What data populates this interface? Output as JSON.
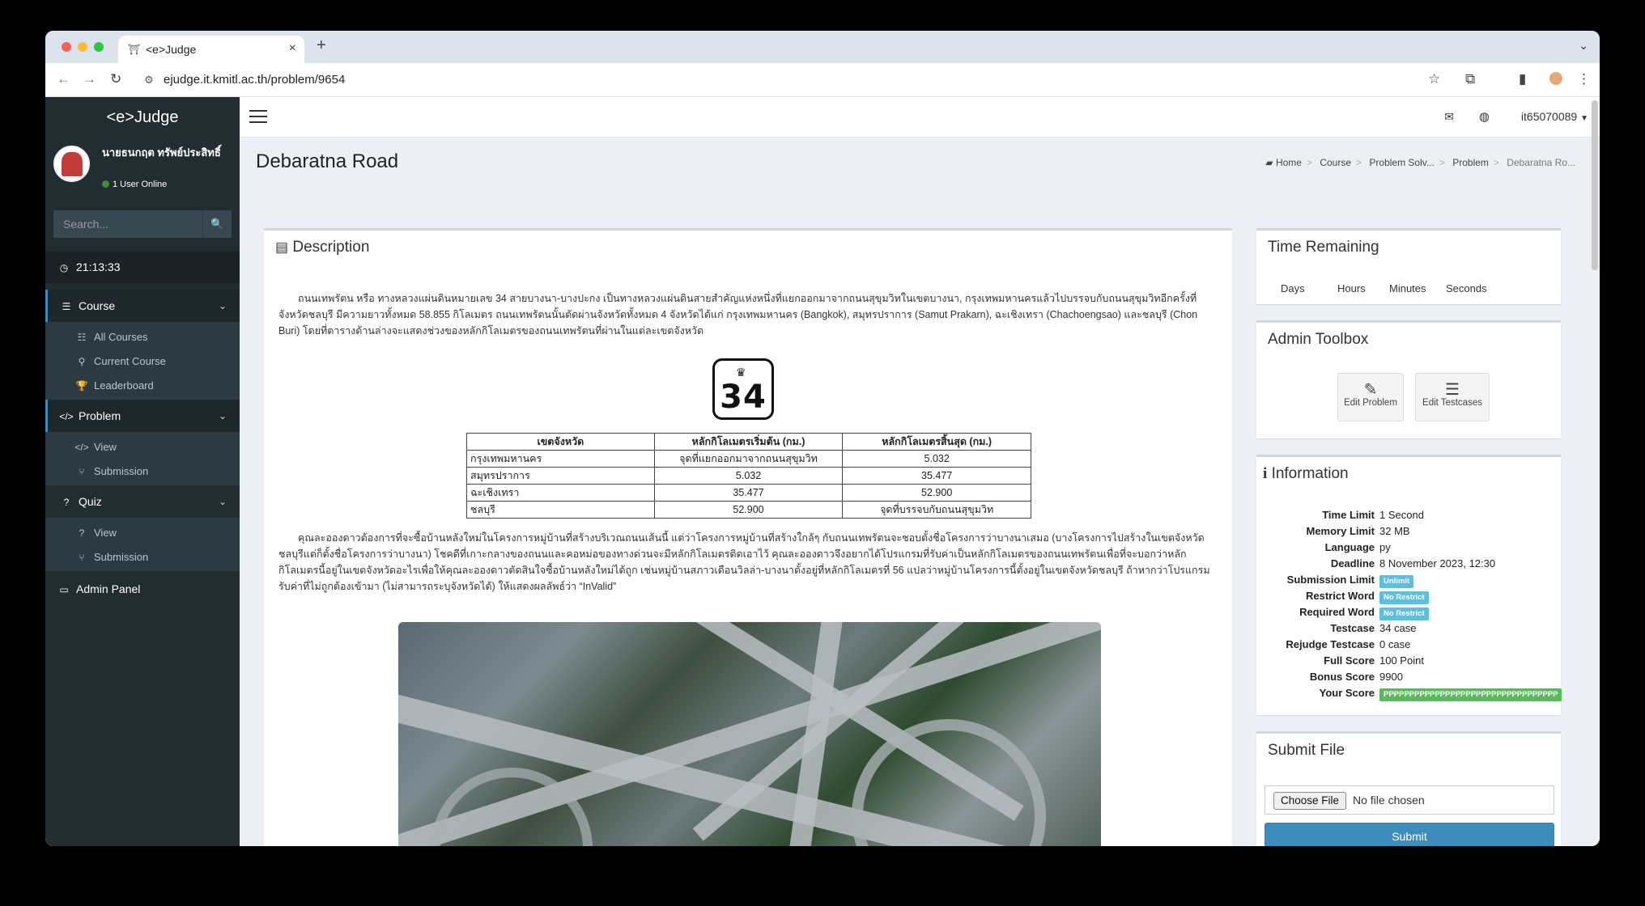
{
  "browser": {
    "tab_title": "<e>Judge",
    "url": "ejudge.it.kmitl.ac.th/problem/9654"
  },
  "sidebar": {
    "logo": "<e>Judge",
    "user_name": "นายธนกฤต ทรัพย์ประสิทธิ์",
    "user_online": "1 User Online",
    "search_placeholder": "Search...",
    "clock": "21:13:33",
    "sections": [
      {
        "label": "Course",
        "icon": "list-icon",
        "items": [
          {
            "label": "All Courses",
            "icon": "list-icon"
          },
          {
            "label": "Current Course",
            "icon": "map-marker-icon"
          },
          {
            "label": "Leaderboard",
            "icon": "trophy-icon"
          }
        ]
      },
      {
        "label": "Problem",
        "icon": "code-icon",
        "items": [
          {
            "label": "View",
            "icon": "code-icon"
          },
          {
            "label": "Submission",
            "icon": "branch-icon"
          }
        ]
      },
      {
        "label": "Quiz",
        "icon": "question-icon",
        "items": [
          {
            "label": "View",
            "icon": "question-icon"
          },
          {
            "label": "Submission",
            "icon": "branch-icon"
          }
        ]
      }
    ],
    "admin_panel": "Admin Panel"
  },
  "navbar": {
    "username": "it65070089"
  },
  "page": {
    "title": "Debaratna Road",
    "breadcrumb": [
      "Home",
      "Course",
      "Problem Solv...",
      "Problem",
      "Debaratna Ro..."
    ]
  },
  "description": {
    "title": "Description",
    "paragraph1": "ถนนเทพรัตน หรือ ทางหลวงแผ่นดินหมายเลข 34 สายบางนา-บางปะกง เป็นทางหลวงแผ่นดินสายสำคัญแห่งหนึ่งที่แยกออกมาจากถนนสุขุมวิทในเขตบางนา, กรุงเทพมหานครแล้วไปบรรจบกับถนนสุขุมวิทอีกครั้งที่จังหวัดชลบุรี มีความยาวทั้งหมด 58.855 กิโลเมตร ถนนเทพรัตนนั้นตัดผ่านจังหวัดทั้งหมด 4 จังหวัดได้แก่ กรุงเทพมหานคร (Bangkok), สมุทรปราการ (Samut Prakarn), ฉะเชิงเทรา (Chachoengsao) และชลบุรี (Chon Buri) โดยที่ตารางด้านล่างจะแสดงช่วงของหลักกิโลเมตรของถนนเทพรัตนที่ผ่านในแต่ละเขตจังหวัด",
    "route_number": "34",
    "table": {
      "headers": [
        "เขตจังหวัด",
        "หลักกิโลเมตรเริ่มต้น (กม.)",
        "หลักกิโลเมตรสิ้นสุด (กม.)"
      ],
      "rows": [
        [
          "กรุงเทพมหานคร",
          "จุดที่แยกออกมาจากถนนสุขุมวิท",
          "5.032"
        ],
        [
          "สมุทรปราการ",
          "5.032",
          "35.477"
        ],
        [
          "ฉะเชิงเทรา",
          "35.477",
          "52.900"
        ],
        [
          "ชลบุรี",
          "52.900",
          "จุดที่บรรจบกับถนนสุขุมวิท"
        ]
      ]
    },
    "paragraph2": "คุณละอองดาวต้องการที่จะซื้อบ้านหลังใหม่ในโครงการหมู่บ้านที่สร้างบริเวณถนนเส้นนี้ แต่ว่าโครงการหมู่บ้านที่สร้างใกล้ๆ กับถนนเทพรัตนจะชอบตั้งชื่อโครงการว่าบางนาเสมอ (บางโครงการไปสร้างในเขตจังหวัดชลบุรีแต่ก็ตั้งชื่อโครงการว่าบางนา) โชคดีที่เกาะกลางของถนนและคอหม่อของทางด่วนจะมีหลักกิโลเมตรติดเอาไว้ คุณละอองดาวจึงอยากได้โปรแกรมที่รับค่าเป็นหลักกิโลเมตรของถนนเทพรัตนเพื่อที่จะบอกว่าหลักกิโลเมตรนี้อยู่ในเขตจังหวัดอะไรเพื่อให้คุณละอองดาวตัดสินใจซื้อบ้านหลังใหม่ได้ถูก เช่นหมู่บ้านสภาวเดือนวิลล่า-บางนาตั้งอยู่ที่หลักกิโลเมตรที่ 56 แปลว่าหมู่บ้านโครงการนี้ตั้งอยู่ในเขตจังหวัดชลบุรี ถ้าหากว่าโปรแกรมรับค่าที่ไม่ถูกต้องเข้ามา (ไม่สามารถระบุจังหวัดได้) ให้แสดงผลลัพธ์ว่า “InValid”"
  },
  "time_remaining": {
    "title": "Time Remaining",
    "labels": [
      "Days",
      "Hours",
      "Minutes",
      "Seconds"
    ]
  },
  "admin_toolbox": {
    "title": "Admin Toolbox",
    "edit_problem": "Edit Problem",
    "edit_testcases": "Edit Testcases"
  },
  "information": {
    "title": "Information",
    "rows": [
      {
        "label": "Time Limit",
        "value": "1 Second"
      },
      {
        "label": "Memory Limit",
        "value": "32 MB"
      },
      {
        "label": "Language",
        "value": "py"
      },
      {
        "label": "Deadline",
        "value": "8 November 2023, 12:30"
      },
      {
        "label": "Submission Limit",
        "value": "Unlimit",
        "badge": "blue"
      },
      {
        "label": "Restrict Word",
        "value": "No Restrict",
        "badge": "blue"
      },
      {
        "label": "Required Word",
        "value": "No Restrict",
        "badge": "blue"
      },
      {
        "label": "Testcase",
        "value": "34 case"
      },
      {
        "label": "Rejudge Testcase",
        "value": "0 case"
      },
      {
        "label": "Full Score",
        "value": "100 Point"
      },
      {
        "label": "Bonus Score",
        "value": "9900"
      },
      {
        "label": "Your Score",
        "value": "PPPPPPPPPPPPPPPPPPPPPPPPPPPPPPPPPP",
        "badge": "green"
      }
    ]
  },
  "submit_file": {
    "title": "Submit File",
    "choose_label": "Choose File",
    "no_file": "No file chosen",
    "submit_label": "Submit"
  },
  "colors": {
    "sidebar_bg": "#222d32",
    "accent": "#3c8dbc",
    "badge_info": "#5bc0de",
    "badge_success": "#5cb85c"
  }
}
